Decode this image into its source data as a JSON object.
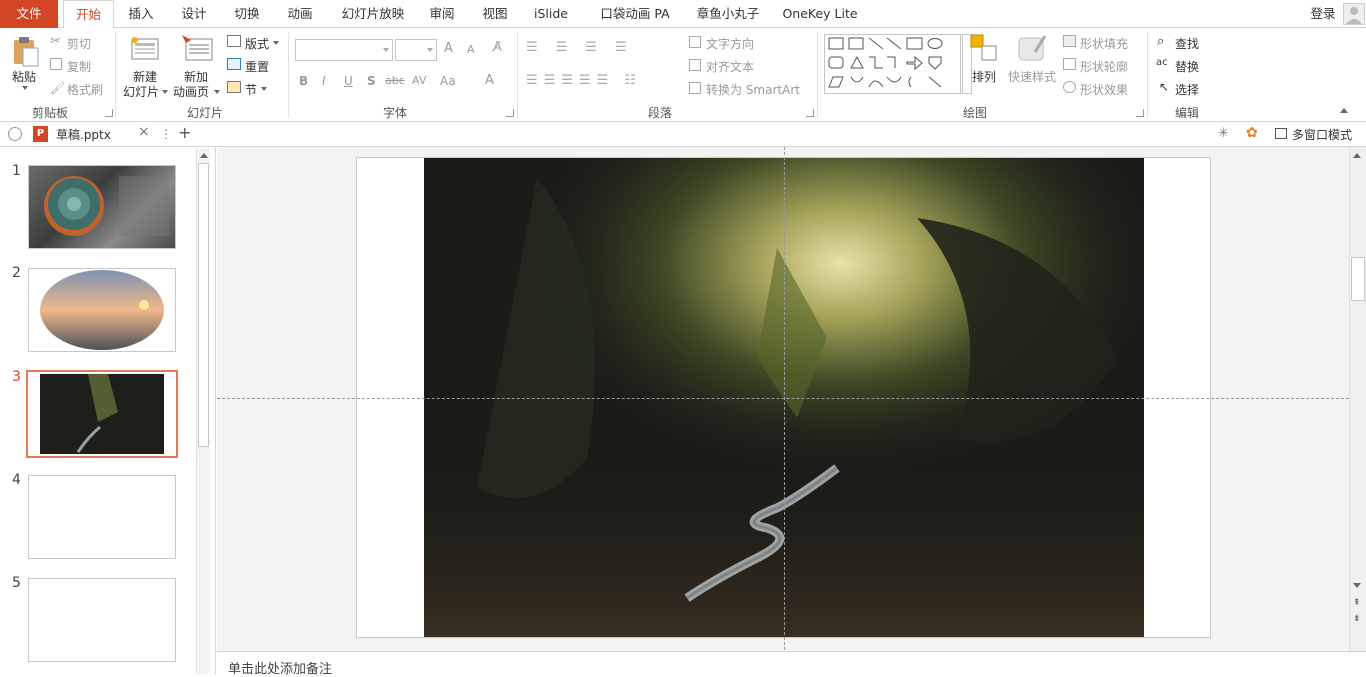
{
  "menu": {
    "tabs": [
      "文件",
      "开始",
      "插入",
      "设计",
      "切换",
      "动画",
      "幻灯片放映",
      "审阅",
      "视图",
      "iSlide",
      "口袋动画 PA",
      "章鱼小丸子",
      "OneKey Lite"
    ],
    "login": "登录"
  },
  "ribbon": {
    "clipboard": {
      "paste": "粘贴",
      "cut": "剪切",
      "copy": "复制",
      "format_painter": "格式刷",
      "label": "剪贴板"
    },
    "slides": {
      "new_slide_1": "新建",
      "new_slide_2": "幻灯片",
      "new_anim_1": "新加",
      "new_anim_2": "动画页",
      "layout": "版式",
      "reset": "重置",
      "section": "节",
      "label": "幻灯片"
    },
    "font": {
      "label": "字体",
      "bold": "B",
      "italic": "I",
      "underline": "U",
      "shadow": "S",
      "strike": "abc",
      "spacing": "AV",
      "case": "Aa",
      "color": "A",
      "grow": "A",
      "shrink": "A"
    },
    "paragraph": {
      "label": "段落",
      "text_direction": "文字方向",
      "align_text": "对齐文本",
      "convert_smartart": "转换为 SmartArt"
    },
    "drawing": {
      "label": "绘图",
      "arrange": "排列",
      "quick_styles": "快速样式",
      "shape_fill": "形状填充",
      "shape_outline": "形状轮廓",
      "shape_effects": "形状效果"
    },
    "editing": {
      "label": "编辑",
      "find": "查找",
      "replace": "替换",
      "select": "选择"
    }
  },
  "docbar": {
    "filename": "草稿.pptx",
    "close": "×",
    "add": "+",
    "multiwindow": "多窗口模式"
  },
  "slides_panel": {
    "numbers": [
      "1",
      "2",
      "3",
      "4",
      "5"
    ],
    "selected": "3"
  },
  "notes": {
    "placeholder": "单击此处添加备注"
  },
  "colors": {
    "accent": "#d24625",
    "selected_border": "#e07b57"
  }
}
